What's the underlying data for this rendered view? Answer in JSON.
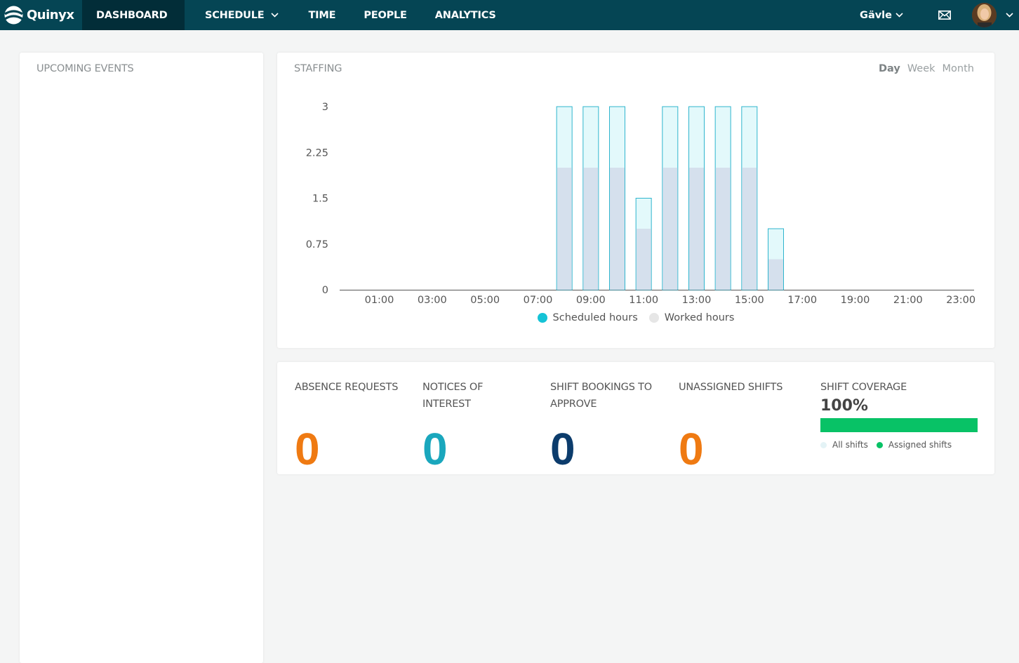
{
  "nav": {
    "brand": "Quinyx",
    "items": [
      {
        "label": "DASHBOARD"
      },
      {
        "label": "SCHEDULE"
      },
      {
        "label": "TIME"
      },
      {
        "label": "PEOPLE"
      },
      {
        "label": "ANALYTICS"
      }
    ],
    "location": "Gävle"
  },
  "upcoming": {
    "title": "UPCOMING EVENTS"
  },
  "staffing": {
    "title": "STAFFING",
    "ranges": [
      "Day",
      "Week",
      "Month"
    ],
    "selected_range": "Day"
  },
  "chart_data": {
    "type": "bar",
    "stacked": true,
    "categories": [
      "00:00",
      "01:00",
      "02:00",
      "03:00",
      "04:00",
      "05:00",
      "06:00",
      "07:00",
      "08:00",
      "09:00",
      "10:00",
      "11:00",
      "12:00",
      "13:00",
      "14:00",
      "15:00",
      "16:00",
      "17:00",
      "18:00",
      "19:00",
      "20:00",
      "21:00",
      "22:00",
      "23:00"
    ],
    "x_tick_labels": [
      "01:00",
      "03:00",
      "05:00",
      "07:00",
      "09:00",
      "11:00",
      "13:00",
      "15:00",
      "17:00",
      "19:00",
      "21:00",
      "23:00"
    ],
    "series": [
      {
        "name": "Scheduled hours",
        "color": "#e3f9fb",
        "stroke": "#2fb5ce",
        "values": [
          0,
          0,
          0,
          0,
          0,
          0,
          0,
          0,
          3,
          3,
          3,
          1.5,
          3,
          3,
          3,
          3,
          1,
          0,
          0,
          0,
          0,
          0,
          0,
          0
        ]
      },
      {
        "name": "Worked hours",
        "color": "#d5e0ed",
        "values": [
          0,
          0,
          0,
          0,
          0,
          0,
          0,
          0,
          2,
          2,
          2,
          1,
          2,
          2,
          2,
          2,
          0.5,
          0,
          0,
          0,
          0,
          0,
          0,
          0
        ]
      }
    ],
    "y_ticks": [
      "0",
      "0.75",
      "1.5",
      "2.25",
      "3"
    ],
    "ylim": [
      0,
      3
    ],
    "legend": [
      {
        "label": "Scheduled hours",
        "color": "#15c3d6"
      },
      {
        "label": "Worked hours",
        "color": "#e6e6e6"
      }
    ],
    "legend_position": "bottom"
  },
  "metrics": [
    {
      "label": "ABSENCE REQUESTS",
      "value": "0",
      "color": "#ef7a12"
    },
    {
      "label": "NOTICES OF INTEREST",
      "value": "0",
      "color": "#1aa7bd"
    },
    {
      "label": "SHIFT BOOKINGS TO APPROVE",
      "value": "0",
      "color": "#0c3c6c"
    },
    {
      "label": "UNASSIGNED SHIFTS",
      "value": "0",
      "color": "#ef7a12"
    }
  ],
  "coverage": {
    "title": "SHIFT COVERAGE",
    "percent_label": "100%",
    "fill_fraction": 1.0,
    "legend": [
      {
        "label": "All shifts",
        "color": "#e4f3f6"
      },
      {
        "label": "Assigned shifts",
        "color": "#08c266"
      }
    ]
  }
}
